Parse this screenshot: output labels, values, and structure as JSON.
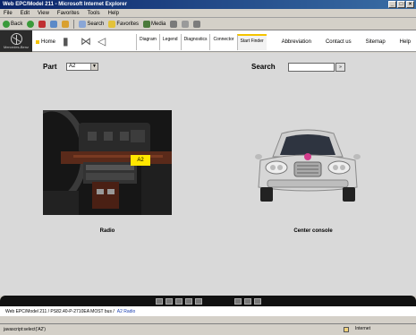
{
  "window": {
    "title": "Web EPC/Model 211 - Microsoft Internet Explorer"
  },
  "menu": [
    "File",
    "Edit",
    "View",
    "Favorites",
    "Tools",
    "Help"
  ],
  "toolbar": {
    "back": "Back",
    "search": "Search",
    "favorites": "Favorites",
    "media": "Media"
  },
  "app": {
    "brand": "Mercedes-Benz",
    "home": "Home",
    "tabs": [
      "Diagram",
      "Legend",
      "Diagnostics",
      "Connector",
      "Start Finder"
    ],
    "active_tab": "Start Finder",
    "links": [
      "Abbreviation",
      "Contact us",
      "Sitemap",
      "Help"
    ]
  },
  "main": {
    "part_label": "Part",
    "part_value": "A2",
    "search_label": "Search",
    "search_value": "",
    "search_button": "»",
    "radio_tag": "A2",
    "radio_caption": "Radio",
    "car_caption": "Center console"
  },
  "breadcrumb": {
    "base": "Web EPC/Model 211 / PS82.40-P-2710EA MOST bus /",
    "current": "A2 Radio"
  },
  "status": {
    "left": "javascript:select('A2')",
    "zone": "Internet"
  },
  "colors": {
    "accent": "#f5c400",
    "title_bar": "#0a246a"
  }
}
